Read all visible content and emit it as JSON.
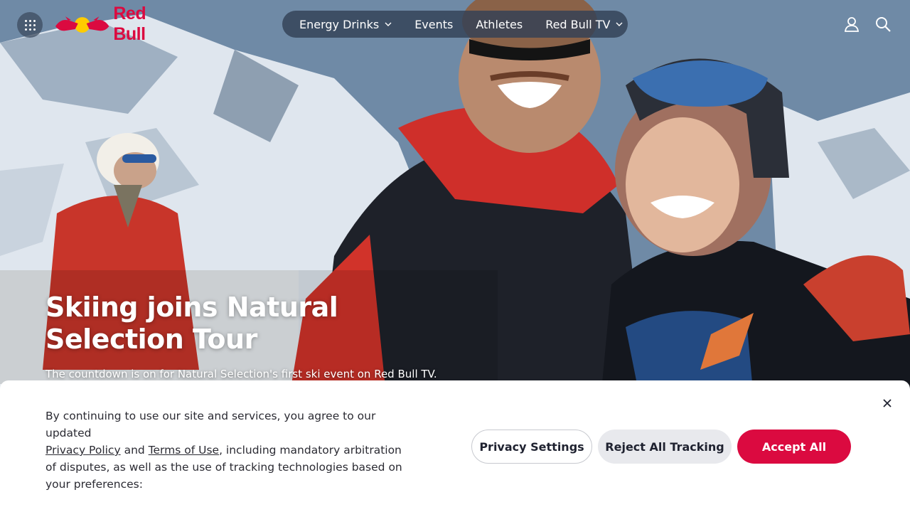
{
  "header": {
    "apps_icon": "grid-dots-icon",
    "logo_text": "Red Bull",
    "nav": [
      {
        "label": "Energy Drinks",
        "has_dropdown": true
      },
      {
        "label": "Events",
        "has_dropdown": false
      },
      {
        "label": "Athletes",
        "has_dropdown": false
      },
      {
        "label": "Red Bull TV",
        "has_dropdown": true
      }
    ],
    "account_icon": "user-icon",
    "search_icon": "search-icon"
  },
  "hero": {
    "title": "Skiing joins Natural Selection Tour",
    "subtitle": "The countdown is on for Natural Selection's first ski event on Red Bull TV."
  },
  "cookie_banner": {
    "text_before": "By continuing to use our site and services, you agree to our updated ",
    "privacy_link": "Privacy Policy",
    "text_and": " and ",
    "terms_link": "Terms of Use",
    "text_after": ", including mandatory arbitration of disputes, as well as the use of tracking technologies based on your preferences:",
    "settings_button": "Privacy Settings",
    "reject_button": "Reject All Tracking",
    "accept_button": "Accept All",
    "close_icon": "close-icon"
  },
  "colors": {
    "brand_red": "#db0a40",
    "nav_bg": "#324155",
    "reject_bg": "#e8e9ed"
  }
}
